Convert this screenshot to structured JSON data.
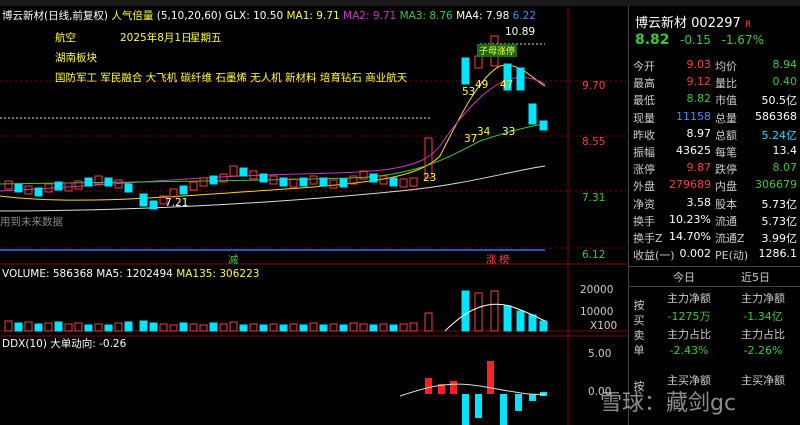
{
  "header": {
    "stock_title": "博云新材(日线,前复权)",
    "popularity": "人气倍量",
    "ma_params": "(5,10,20,60)",
    "glx": "GLX: 10.50",
    "ma1": "MA1: 9.71",
    "ma2": "MA2: 9.71",
    "ma3": "MA3: 8.76",
    "ma4": "MA4: 7.98",
    "last": "6.22"
  },
  "overlay_text": {
    "sector1": "航空",
    "date": "2025年8月1日",
    "weekday": "星期五",
    "sector2": "湖南板块",
    "concepts": "国防军工 军民融合 大飞机 碳纤维 石墨烯 无人机 新材料 培育钻石 商业航天",
    "high_label": "10.89",
    "low_label": "7.21",
    "future_label": "用到未来数据",
    "tag_reduce": "减",
    "tag_up": "涨",
    "tag_limit": "榜",
    "seg_23": "23",
    "seg_53": "53",
    "seg_49": "49",
    "seg_47": "47",
    "seg_37": "37",
    "seg_34": "34",
    "seg_33": "33",
    "badge": "子母涨停"
  },
  "price_axis": {
    "p1": "9.70",
    "p2": "8.55",
    "p3": "7.31",
    "p4": "6.12"
  },
  "volume": {
    "title": "VOLUME: 586368",
    "ma5": "MA5: 1202494",
    "ma135": "MA135: 306223",
    "axis1": "20000",
    "axis2": "10000",
    "axis3": "X100"
  },
  "ddx": {
    "title": "DDX(10) 大单动向: -0.26",
    "axis1": "5.00",
    "axis2": "0.00"
  },
  "quote": {
    "name": "博云新材",
    "code": "002297",
    "flag": "R",
    "price": "8.82",
    "change": "-0.15",
    "change_pct": "-1.67%",
    "rows": [
      {
        "l1": "今开",
        "v1": "9.03",
        "c1": "red",
        "l2": "均价",
        "v2": "8.94",
        "c2": "green"
      },
      {
        "l1": "最高",
        "v1": "9.12",
        "c1": "red",
        "l2": "量比",
        "v2": "0.40",
        "c2": "green"
      },
      {
        "l1": "最低",
        "v1": "8.82",
        "c1": "green",
        "l2": "市值",
        "v2": "50.5亿",
        "c2": "white"
      },
      {
        "l1": "现量",
        "v1": "11158",
        "c1": "blue",
        "l2": "总量",
        "v2": "586368",
        "c2": "white"
      },
      {
        "l1": "昨收",
        "v1": "8.97",
        "c1": "white",
        "l2": "总额",
        "v2": "5.24亿",
        "c2": "cyan"
      },
      {
        "l1": "振幅",
        "v1": "43625",
        "c1": "white",
        "l2": "每笔",
        "v2": "13.4",
        "c2": "white"
      },
      {
        "l1": "涨停",
        "v1": "9.87",
        "c1": "red",
        "l2": "跌停",
        "v2": "8.07",
        "c2": "green"
      },
      {
        "l1": "外盘",
        "v1": "279689",
        "c1": "red",
        "l2": "内盘",
        "v2": "306679",
        "c2": "green"
      },
      {
        "l1": "净资",
        "v1": "3.58",
        "c1": "white",
        "l2": "股本",
        "v2": "5.73亿",
        "c2": "white"
      },
      {
        "l1": "换手",
        "v1": "10.23%",
        "c1": "white",
        "l2": "流通",
        "v2": "5.73亿",
        "c2": "white"
      },
      {
        "l1": "换手Z",
        "v1": "14.70%",
        "c1": "white",
        "l2": "流通Z",
        "v2": "3.99亿",
        "c2": "white"
      },
      {
        "l1": "收益(一)",
        "v1": "0.002",
        "c1": "white",
        "l2": "PE(动)",
        "v2": "1286.1",
        "c2": "white"
      }
    ],
    "tab_today": "今日",
    "tab_5day": "近5日",
    "side_label1": "按买卖单",
    "side_label2": "按",
    "row_a_l": "主力净额",
    "row_a_r": "主力净额",
    "row_a_lv": "-1275万",
    "row_a_rv": "-1.34亿",
    "row_b_l": "主力占比",
    "row_b_r": "主力占比",
    "row_b_lv": "-2.43%",
    "row_b_rv": "-2.26%",
    "row_c_l": "主买净额",
    "row_c_r": "主买净额",
    "watermark": "雪球：藏剑gc"
  }
}
